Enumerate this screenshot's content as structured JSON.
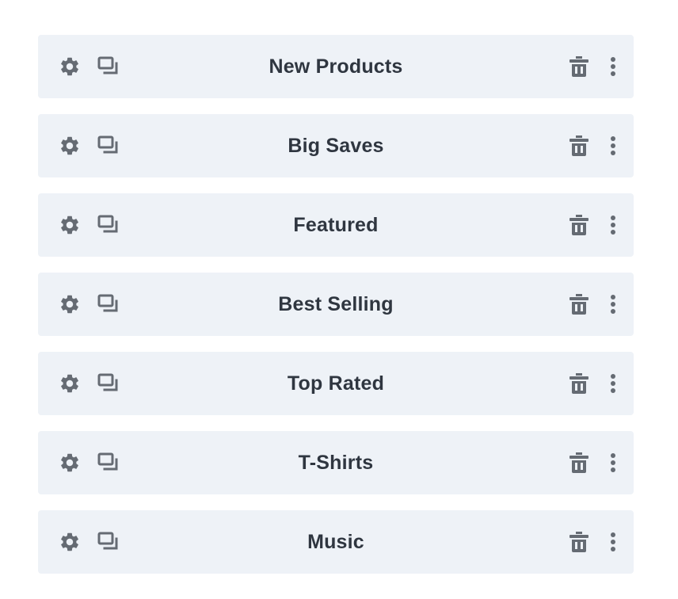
{
  "colors": {
    "row_background": "#eef2f7",
    "icon": "#656b73",
    "label": "#2f3640"
  },
  "icons": {
    "settings": "gear-icon",
    "duplicate": "duplicate-icon",
    "delete": "trash-icon",
    "more": "more-vertical-icon"
  },
  "modules": [
    {
      "label": "New Products"
    },
    {
      "label": "Big Saves"
    },
    {
      "label": "Featured"
    },
    {
      "label": "Best Selling"
    },
    {
      "label": "Top Rated"
    },
    {
      "label": "T-Shirts"
    },
    {
      "label": "Music"
    }
  ]
}
